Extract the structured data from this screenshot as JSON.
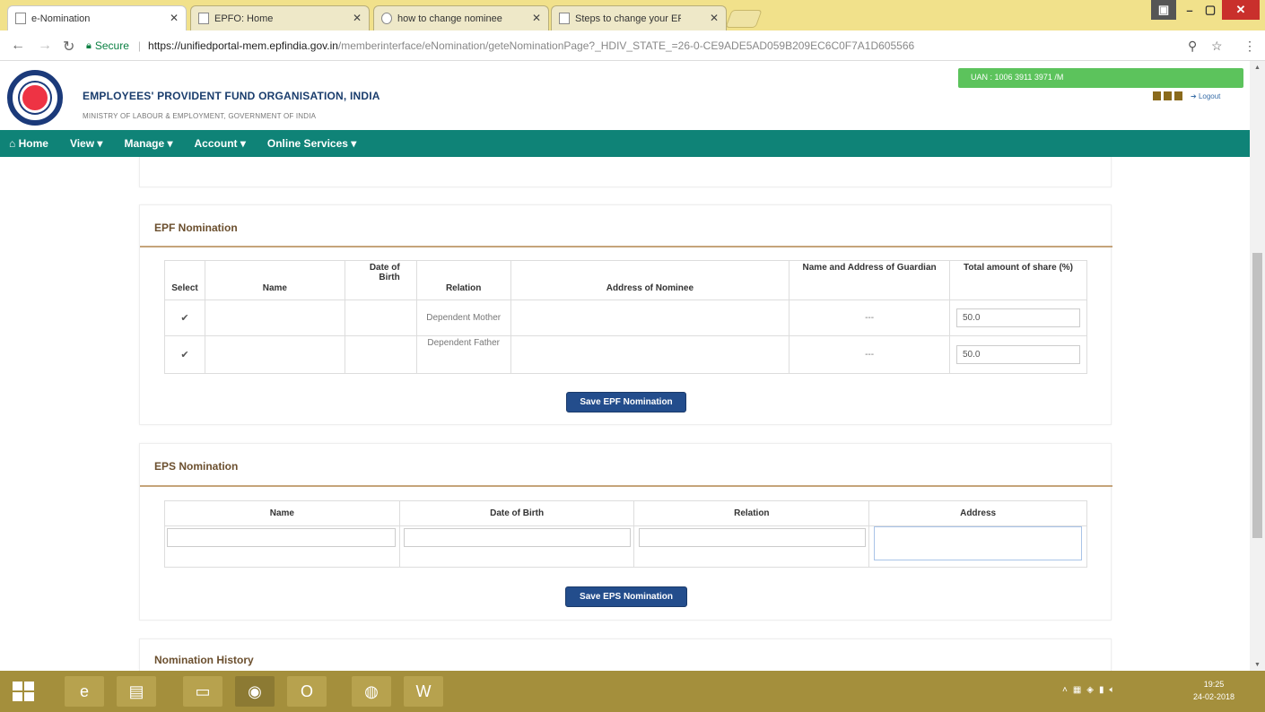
{
  "browser": {
    "tabs": [
      {
        "label": "e-Nomination",
        "active": true
      },
      {
        "label": "EPFO: Home",
        "active": false
      },
      {
        "label": "how to change nominee",
        "active": false
      },
      {
        "label": "Steps to change your EP",
        "active": false
      }
    ],
    "secure_label": "Secure",
    "url_host": "https://unifiedportal-mem.epfindia.gov.in",
    "url_path": "/memberinterface/eNomination/geteNominationPage?_HDIV_STATE_=26-0-CE9ADE5AD059B209EC6C0F7A1D605566",
    "icons": [
      "back-icon",
      "forward-icon",
      "reload-icon",
      "lock-icon",
      "zoom-icon",
      "star-icon",
      "menu-icon"
    ]
  },
  "header": {
    "org_title": "EMPLOYEES' PROVIDENT FUND ORGANISATION, INDIA",
    "org_subtitle": "MINISTRY OF LABOUR & EMPLOYMENT, GOVERNMENT OF INDIA",
    "uan": "UAN : 1006 3911 3971 /M",
    "logout": "Logout"
  },
  "nav": {
    "items": [
      "Home",
      "View",
      "Manage",
      "Account",
      "Online Services"
    ]
  },
  "epf": {
    "title": "EPF Nomination",
    "columns": [
      "Select",
      "Name",
      "Date of Birth",
      "Relation",
      "Address of Nominee",
      "Name and Address of Guardian",
      "Total amount of share (%)"
    ],
    "rows": [
      {
        "select": "✔",
        "name": "",
        "dob": "",
        "relation": "Dependent Mother",
        "address": "",
        "guardian": "---",
        "share": "50.0"
      },
      {
        "select": "✔",
        "name": "",
        "dob": "",
        "relation": "Dependent Father",
        "address": "",
        "guardian": "---",
        "share": "50.0"
      }
    ],
    "save_label": "Save EPF Nomination"
  },
  "eps": {
    "title": "EPS Nomination",
    "columns": [
      "Name",
      "Date of Birth",
      "Relation",
      "Address"
    ],
    "save_label": "Save EPS Nomination"
  },
  "history": {
    "title": "Nomination History"
  },
  "taskbar": {
    "apps": [
      "start",
      "ie",
      "file-explorer",
      "folder",
      "chrome",
      "outlook",
      "firefox",
      "word"
    ],
    "time": "19:25",
    "date": "24-02-2018"
  },
  "colors": {
    "nav_bg": "#0f8377",
    "button_bg": "#234d8c",
    "uan_bg": "#5cc35c",
    "panel_title": "#6b4f2e",
    "taskbar": "#a48f3c"
  }
}
